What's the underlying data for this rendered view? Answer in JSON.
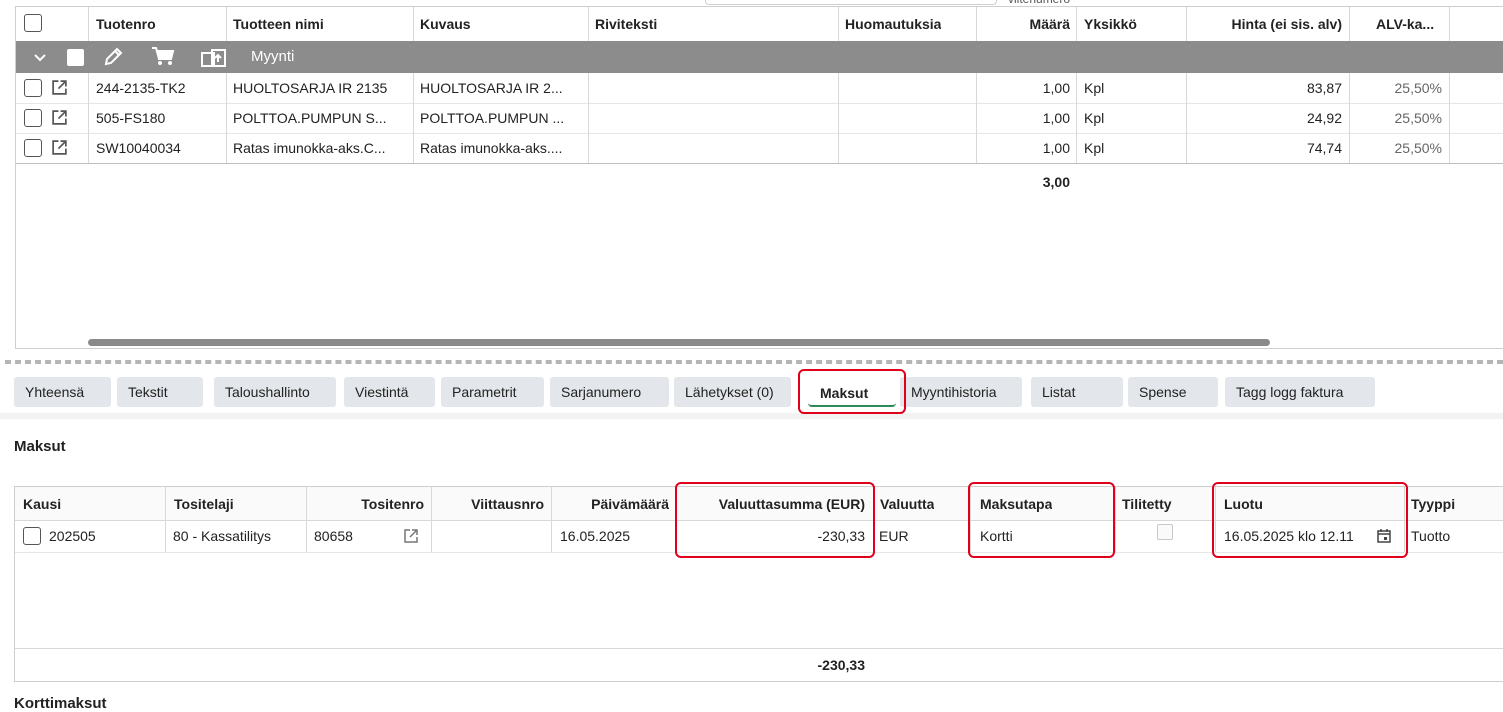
{
  "top_cutoff_text": "viitenumero",
  "products_table": {
    "columns": {
      "tuotenro": "Tuotenro",
      "nimi": "Tuotteen nimi",
      "kuvaus": "Kuvaus",
      "riviteksti": "Riviteksti",
      "huomautuksia": "Huomautuksia",
      "maara": "Määrä",
      "yksikko": "Yksikkö",
      "hinta": "Hinta (ei sis. alv)",
      "alv": "ALV-ka..."
    },
    "group_label": "Myynti",
    "rows": [
      {
        "tuotenro": "244-2135-TK2",
        "nimi": "HUOLTOSARJA IR 2135",
        "kuvaus": "HUOLTOSARJA IR 2...",
        "maara": "1,00",
        "yksikko": "Kpl",
        "hinta": "83,87",
        "alv": "25,50%"
      },
      {
        "tuotenro": "505-FS180",
        "nimi": "POLTTOA.PUMPUN S...",
        "kuvaus": "POLTTOA.PUMPUN ...",
        "maara": "1,00",
        "yksikko": "Kpl",
        "hinta": "24,92",
        "alv": "25,50%"
      },
      {
        "tuotenro": "SW10040034",
        "nimi": "Ratas imunokka-aks.C...",
        "kuvaus": "Ratas imunokka-aks....",
        "maara": "1,00",
        "yksikko": "Kpl",
        "hinta": "74,74",
        "alv": "25,50%"
      }
    ],
    "total_maara": "3,00"
  },
  "tabs": [
    {
      "label": "Yhteensä"
    },
    {
      "label": "Tekstit"
    },
    {
      "label": "Taloushallinto"
    },
    {
      "label": "Viestintä"
    },
    {
      "label": "Parametrit"
    },
    {
      "label": "Sarjanumero"
    },
    {
      "label": "Lähetykset (0)"
    },
    {
      "label": "Maksut",
      "active": true
    },
    {
      "label": "Myyntihistoria"
    },
    {
      "label": "Listat"
    },
    {
      "label": "Spense"
    },
    {
      "label": "Tagg logg faktura"
    }
  ],
  "payments": {
    "section_title": "Maksut",
    "columns": {
      "kausi": "Kausi",
      "tositelaji": "Tositelaji",
      "tositenro": "Tositenro",
      "viittausnro": "Viittausnro",
      "paivamaara": "Päivämäärä",
      "valuuttasumma": "Valuuttasumma (EUR)",
      "valuutta": "Valuutta",
      "maksutapa": "Maksutapa",
      "tilitetty": "Tilitetty",
      "luotu": "Luotu",
      "tyyppi": "Tyyppi"
    },
    "row": {
      "kausi": "202505",
      "tositelaji": "80 - Kassatilitys",
      "tositenro": "80658",
      "viittausnro": "",
      "paivamaara": "16.05.2025",
      "valuuttasumma": "-230,33",
      "valuutta": "EUR",
      "maksutapa": "Kortti",
      "tilitetty": false,
      "luotu": "16.05.2025 klo 12.11",
      "tyyppi": "Tuotto"
    },
    "total": "-230,33"
  },
  "next_section_title": "Korttimaksut",
  "colors": {
    "highlight": "#e0001b",
    "group_bar": "#8c8c8c",
    "tab_bg": "#e3e6ea",
    "active_tab_underline": "#2e8b57"
  }
}
